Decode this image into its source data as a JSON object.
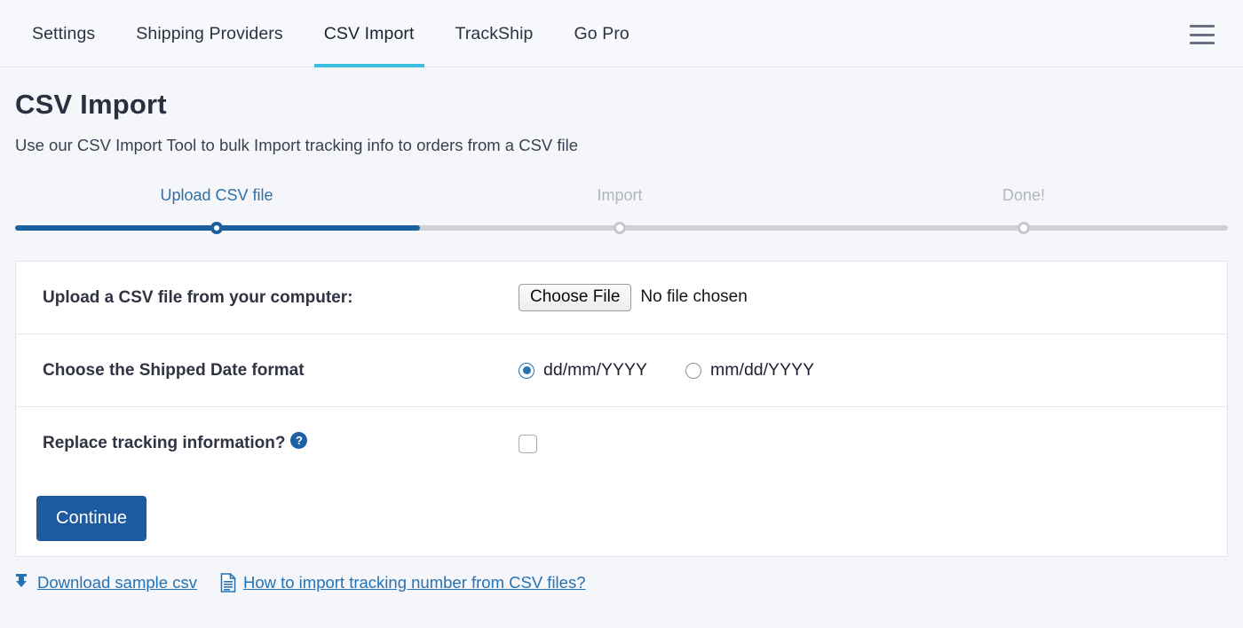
{
  "nav": {
    "tabs": [
      {
        "label": "Settings",
        "active": false
      },
      {
        "label": "Shipping Providers",
        "active": false
      },
      {
        "label": "CSV Import",
        "active": true
      },
      {
        "label": "TrackShip",
        "active": false
      },
      {
        "label": "Go Pro",
        "active": false
      }
    ],
    "menu_icon": "hamburger-menu-icon"
  },
  "header": {
    "title": "CSV Import",
    "subtitle": "Use our CSV Import Tool to bulk Import tracking info to orders from a CSV file"
  },
  "stepper": {
    "steps": [
      {
        "label": "Upload CSV file",
        "state": "current"
      },
      {
        "label": "Import",
        "state": "pending"
      },
      {
        "label": "Done!",
        "state": "pending"
      }
    ],
    "progress_percent": 33,
    "active_color": "#1c5f9e",
    "inactive_color": "#cfd1d5"
  },
  "form": {
    "upload_row": {
      "label": "Upload a CSV file from your computer:",
      "button_label": "Choose File",
      "file_status": "No file chosen"
    },
    "date_format_row": {
      "label": "Choose the Shipped Date format",
      "options": [
        {
          "label": "dd/mm/YYYY",
          "checked": true
        },
        {
          "label": "mm/dd/YYYY",
          "checked": false
        }
      ]
    },
    "replace_row": {
      "label": "Replace tracking information?",
      "help_icon_glyph": "?",
      "checked": false
    },
    "submit_label": "Continue"
  },
  "footer": {
    "links": [
      {
        "label": "Download sample csv",
        "icon": "download-icon"
      },
      {
        "label": "How to import tracking number from CSV files?",
        "icon": "document-icon"
      }
    ]
  },
  "colors": {
    "accent_tab": "#3cbfdd",
    "primary_blue": "#1e5b9e",
    "link_blue": "#2572b4",
    "page_bg": "#f5f6f9"
  }
}
